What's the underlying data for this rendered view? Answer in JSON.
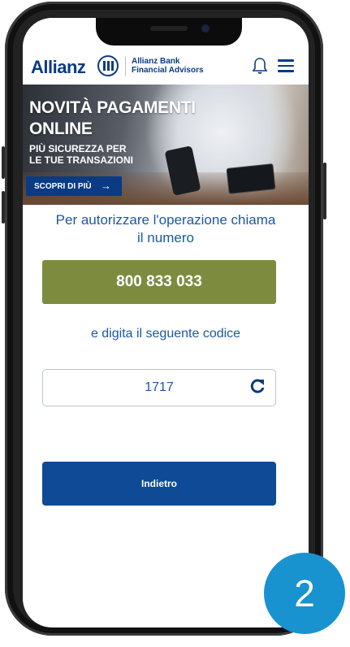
{
  "header": {
    "brand": "Allianz",
    "logo_icon": "allianz-eagle-icon",
    "bank_line1": "Allianz Bank",
    "bank_line2": "Financial Advisors",
    "notification_icon": "bell-icon",
    "menu_icon": "hamburger-menu-icon"
  },
  "banner": {
    "title_line1": "NOVITÀ PAGAMENTI",
    "title_line2": "ONLINE",
    "subtitle_line1": "PIÙ SICUREZZA PER",
    "subtitle_line2": "LE TUE TRANSAZIONI",
    "cta_label": "SCOPRI DI PIÙ",
    "cta_arrow": "→"
  },
  "auth": {
    "instruction_line1": "Per autorizzare l'operazione chiama",
    "instruction_line2": "il numero",
    "phone_number": "800 833 033",
    "code_instruction": "e digita il seguente codice",
    "code": "1717",
    "refresh_icon": "refresh-icon",
    "back_label": "Indietro"
  },
  "step": {
    "number": "2",
    "color": "#1893cf"
  },
  "colors": {
    "brand_blue": "#0a3b83",
    "phone_button": "#7d8b3f",
    "back_button": "#0e4a95",
    "text_blue": "#1c57a5"
  }
}
